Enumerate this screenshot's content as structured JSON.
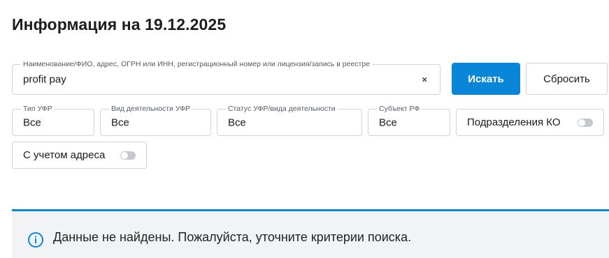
{
  "page_title": "Информация на 19.12.2025",
  "search": {
    "label": "Наименование/ФИО, адрес, ОГРН или ИНН, регистрационный номер или лицензия/запись в реестре",
    "value": "profit pay",
    "clear_symbol": "×"
  },
  "buttons": {
    "search_label": "Искать",
    "reset_label": "Сбросить"
  },
  "filters": {
    "type": {
      "label": "Тип УФР",
      "value": "Все"
    },
    "activity": {
      "label": "Вид деятельности УФР",
      "value": "Все"
    },
    "status": {
      "label": "Статус УФР/вида деятельности",
      "value": "Все"
    },
    "region": {
      "label": "Субъект РФ",
      "value": "Все"
    }
  },
  "toggles": {
    "ko_divisions": {
      "label": "Подразделения КО",
      "enabled": false
    },
    "with_address": {
      "label": "С учетом адреса",
      "enabled": false
    }
  },
  "notice": {
    "message": "Данные не найдены. Пожалуйста, уточните критерии поиска.",
    "icon": "info-icon"
  },
  "colors": {
    "accent": "#0a86d8",
    "notice_bg": "#f2f3f4",
    "border": "#cfd3d8"
  }
}
